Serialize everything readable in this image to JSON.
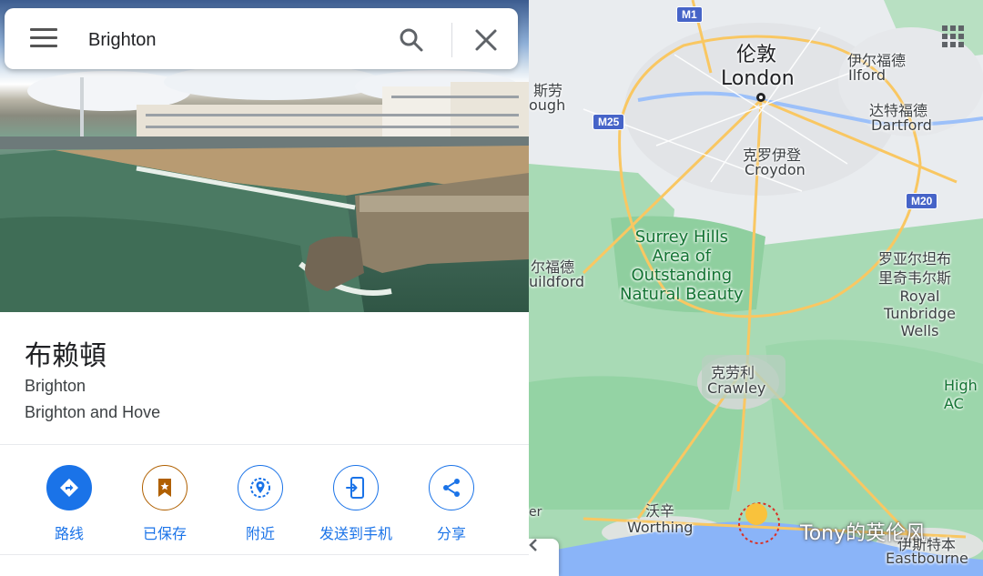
{
  "search": {
    "value": "Brighton",
    "menu_icon": "hamburger-menu-icon",
    "search_icon": "search-icon",
    "close_icon": "close-icon"
  },
  "place": {
    "name_cn": "布赖頓",
    "name_en": "Brighton",
    "region": "Brighton and Hove"
  },
  "actions": [
    {
      "label": "路线",
      "icon": "directions-icon"
    },
    {
      "label": "已保存",
      "icon": "bookmark-icon"
    },
    {
      "label": "附近",
      "icon": "nearby-icon"
    },
    {
      "label": "发送到手机",
      "icon": "send-to-phone-icon"
    },
    {
      "label": "分享",
      "icon": "share-icon"
    }
  ],
  "map": {
    "labels": {
      "london_cn": "伦敦",
      "london_en": "London",
      "ilford_cn": "伊尔福德",
      "ilford_en": "Ilford",
      "dartford_cn": "达特福德",
      "dartford_en": "Dartford",
      "croydon_cn": "克罗伊登",
      "croydon_en": "Croydon",
      "slough_cn": "斯劳",
      "slough_en": "ough",
      "guildford_cn": "尔福德",
      "guildford_en": "uildford",
      "surrey": "Surrey Hills\nArea of\nOutstanding\nNatural Beauty",
      "tunbridge_cn": "罗亚尔坦布\n里奇韦尔斯",
      "tunbridge_en": "Royal\nTunbridge\nWells",
      "crawley_cn": "克劳利",
      "crawley_en": "Crawley",
      "worthing_cn": "沃辛",
      "worthing_en": "Worthing",
      "eastbourne_cn": "伊斯特本",
      "eastbourne_en": "Eastbourne",
      "high_partial": "High\nAC",
      "edge_er": "er"
    },
    "roads": [
      "M1",
      "M25",
      "M20"
    ],
    "grid_icon": "apps-grid-icon",
    "collapse_icon": "chevron-left-icon",
    "watermark": "Tony的英伦风"
  }
}
